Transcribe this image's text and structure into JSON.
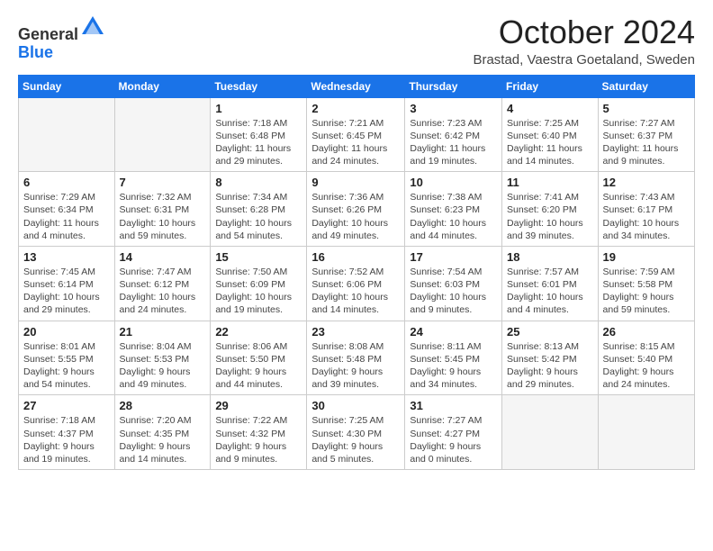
{
  "header": {
    "logo_general": "General",
    "logo_blue": "Blue",
    "month_title": "October 2024",
    "location": "Brastad, Vaestra Goetaland, Sweden"
  },
  "days_of_week": [
    "Sunday",
    "Monday",
    "Tuesday",
    "Wednesday",
    "Thursday",
    "Friday",
    "Saturday"
  ],
  "weeks": [
    [
      {
        "day": "",
        "empty": true
      },
      {
        "day": "",
        "empty": true
      },
      {
        "day": "1",
        "sunrise": "7:18 AM",
        "sunset": "6:48 PM",
        "daylight": "11 hours and 29 minutes."
      },
      {
        "day": "2",
        "sunrise": "7:21 AM",
        "sunset": "6:45 PM",
        "daylight": "11 hours and 24 minutes."
      },
      {
        "day": "3",
        "sunrise": "7:23 AM",
        "sunset": "6:42 PM",
        "daylight": "11 hours and 19 minutes."
      },
      {
        "day": "4",
        "sunrise": "7:25 AM",
        "sunset": "6:40 PM",
        "daylight": "11 hours and 14 minutes."
      },
      {
        "day": "5",
        "sunrise": "7:27 AM",
        "sunset": "6:37 PM",
        "daylight": "11 hours and 9 minutes."
      }
    ],
    [
      {
        "day": "6",
        "sunrise": "7:29 AM",
        "sunset": "6:34 PM",
        "daylight": "11 hours and 4 minutes."
      },
      {
        "day": "7",
        "sunrise": "7:32 AM",
        "sunset": "6:31 PM",
        "daylight": "10 hours and 59 minutes."
      },
      {
        "day": "8",
        "sunrise": "7:34 AM",
        "sunset": "6:28 PM",
        "daylight": "10 hours and 54 minutes."
      },
      {
        "day": "9",
        "sunrise": "7:36 AM",
        "sunset": "6:26 PM",
        "daylight": "10 hours and 49 minutes."
      },
      {
        "day": "10",
        "sunrise": "7:38 AM",
        "sunset": "6:23 PM",
        "daylight": "10 hours and 44 minutes."
      },
      {
        "day": "11",
        "sunrise": "7:41 AM",
        "sunset": "6:20 PM",
        "daylight": "10 hours and 39 minutes."
      },
      {
        "day": "12",
        "sunrise": "7:43 AM",
        "sunset": "6:17 PM",
        "daylight": "10 hours and 34 minutes."
      }
    ],
    [
      {
        "day": "13",
        "sunrise": "7:45 AM",
        "sunset": "6:14 PM",
        "daylight": "10 hours and 29 minutes."
      },
      {
        "day": "14",
        "sunrise": "7:47 AM",
        "sunset": "6:12 PM",
        "daylight": "10 hours and 24 minutes."
      },
      {
        "day": "15",
        "sunrise": "7:50 AM",
        "sunset": "6:09 PM",
        "daylight": "10 hours and 19 minutes."
      },
      {
        "day": "16",
        "sunrise": "7:52 AM",
        "sunset": "6:06 PM",
        "daylight": "10 hours and 14 minutes."
      },
      {
        "day": "17",
        "sunrise": "7:54 AM",
        "sunset": "6:03 PM",
        "daylight": "10 hours and 9 minutes."
      },
      {
        "day": "18",
        "sunrise": "7:57 AM",
        "sunset": "6:01 PM",
        "daylight": "10 hours and 4 minutes."
      },
      {
        "day": "19",
        "sunrise": "7:59 AM",
        "sunset": "5:58 PM",
        "daylight": "9 hours and 59 minutes."
      }
    ],
    [
      {
        "day": "20",
        "sunrise": "8:01 AM",
        "sunset": "5:55 PM",
        "daylight": "9 hours and 54 minutes."
      },
      {
        "day": "21",
        "sunrise": "8:04 AM",
        "sunset": "5:53 PM",
        "daylight": "9 hours and 49 minutes."
      },
      {
        "day": "22",
        "sunrise": "8:06 AM",
        "sunset": "5:50 PM",
        "daylight": "9 hours and 44 minutes."
      },
      {
        "day": "23",
        "sunrise": "8:08 AM",
        "sunset": "5:48 PM",
        "daylight": "9 hours and 39 minutes."
      },
      {
        "day": "24",
        "sunrise": "8:11 AM",
        "sunset": "5:45 PM",
        "daylight": "9 hours and 34 minutes."
      },
      {
        "day": "25",
        "sunrise": "8:13 AM",
        "sunset": "5:42 PM",
        "daylight": "9 hours and 29 minutes."
      },
      {
        "day": "26",
        "sunrise": "8:15 AM",
        "sunset": "5:40 PM",
        "daylight": "9 hours and 24 minutes."
      }
    ],
    [
      {
        "day": "27",
        "sunrise": "7:18 AM",
        "sunset": "4:37 PM",
        "daylight": "9 hours and 19 minutes."
      },
      {
        "day": "28",
        "sunrise": "7:20 AM",
        "sunset": "4:35 PM",
        "daylight": "9 hours and 14 minutes."
      },
      {
        "day": "29",
        "sunrise": "7:22 AM",
        "sunset": "4:32 PM",
        "daylight": "9 hours and 9 minutes."
      },
      {
        "day": "30",
        "sunrise": "7:25 AM",
        "sunset": "4:30 PM",
        "daylight": "9 hours and 5 minutes."
      },
      {
        "day": "31",
        "sunrise": "7:27 AM",
        "sunset": "4:27 PM",
        "daylight": "9 hours and 0 minutes."
      },
      {
        "day": "",
        "empty": true
      },
      {
        "day": "",
        "empty": true
      }
    ]
  ]
}
